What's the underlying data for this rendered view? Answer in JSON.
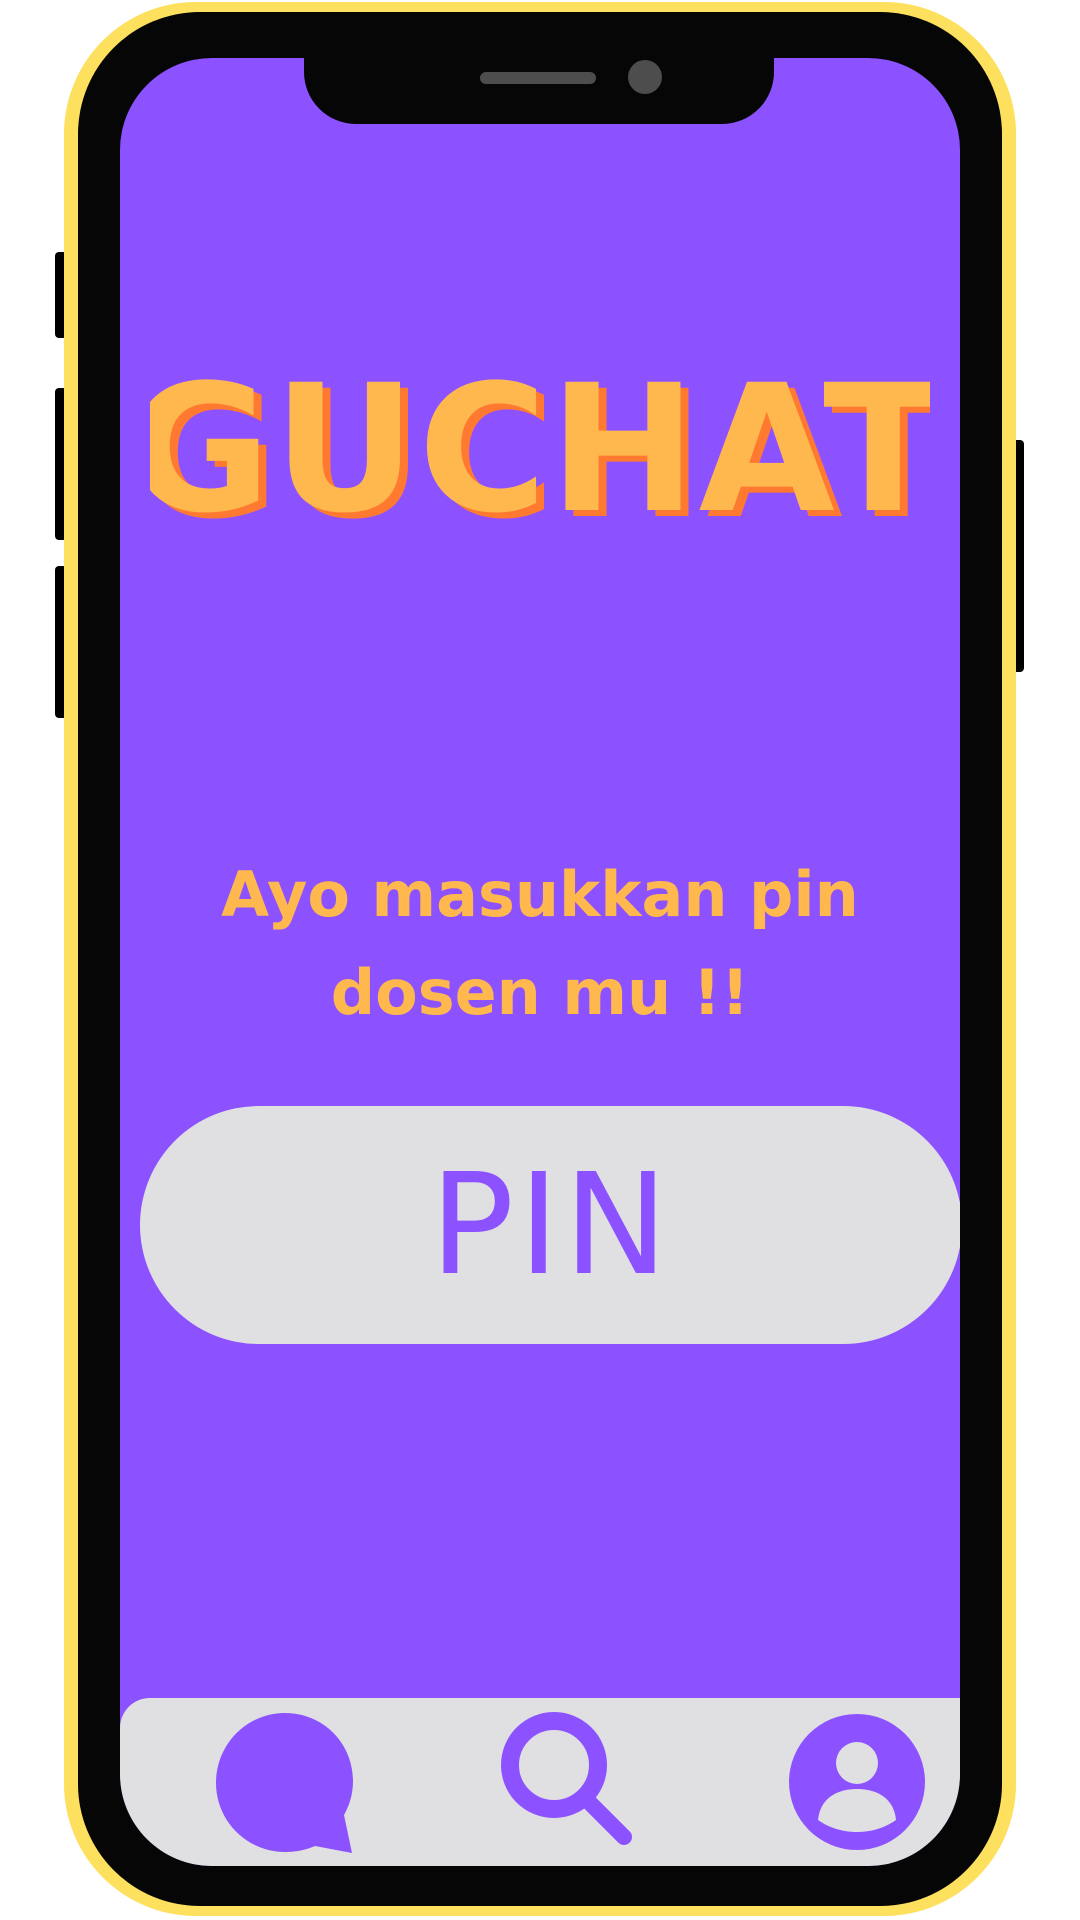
{
  "app": {
    "logo_text": "GUCHAT"
  },
  "main": {
    "prompt_line1": "Ayo masukkan pin",
    "prompt_line2": "dosen mu !!",
    "pin_placeholder": "PIN"
  },
  "tabbar": {
    "items": [
      {
        "name": "chat",
        "icon": "chat-bubble-icon"
      },
      {
        "name": "search",
        "icon": "search-icon"
      },
      {
        "name": "profile",
        "icon": "user-profile-icon"
      }
    ]
  },
  "colors": {
    "screen_background": "#8c52ff",
    "frame": "#fde05e",
    "accent_text": "#ffb84d",
    "logo_shadow": "#ff7a30",
    "input_background": "#e0e0e2"
  }
}
